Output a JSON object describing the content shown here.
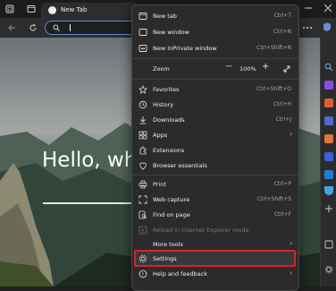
{
  "tab": {
    "title": "New Tab"
  },
  "page": {
    "heading": "Hello, wha"
  },
  "menu": {
    "items": [
      {
        "label": "New tab",
        "shortcut": "Ctrl+T"
      },
      {
        "label": "New window",
        "shortcut": "Ctrl+N"
      },
      {
        "label": "New InPrivate window",
        "shortcut": "Ctrl+Shift+N"
      },
      {
        "label": "Zoom",
        "zoom_value": "100%",
        "zoom_minus": "—",
        "zoom_plus": "+"
      },
      {
        "label": "Favorites",
        "shortcut": "Ctrl+Shift+O"
      },
      {
        "label": "History",
        "shortcut": "Ctrl+H"
      },
      {
        "label": "Downloads",
        "shortcut": "Ctrl+J"
      },
      {
        "label": "Apps"
      },
      {
        "label": "Extensions"
      },
      {
        "label": "Browser essentials"
      },
      {
        "label": "Print",
        "shortcut": "Ctrl+P"
      },
      {
        "label": "Web capture",
        "shortcut": "Ctrl+Shift+S"
      },
      {
        "label": "Find on page",
        "shortcut": "Ctrl+F"
      },
      {
        "label": "Reload in Internet Explorer mode"
      },
      {
        "label": "More tools"
      },
      {
        "label": "Settings"
      },
      {
        "label": "Help and feedback"
      }
    ]
  },
  "colors": {
    "highlight": "#d3232a",
    "address_border": "#5b8fd9"
  }
}
